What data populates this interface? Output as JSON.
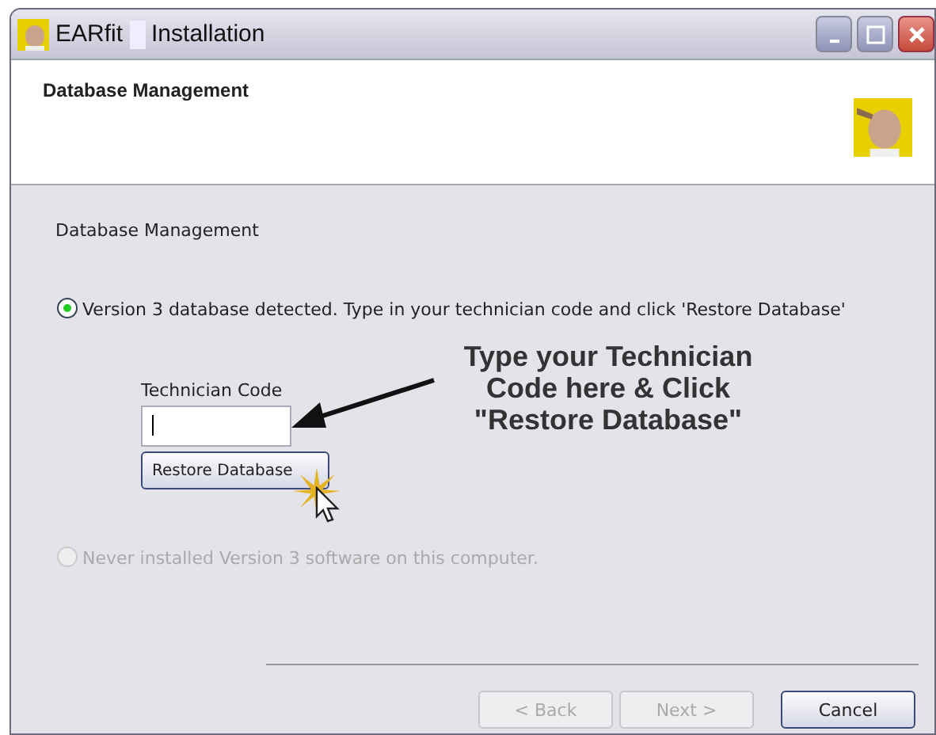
{
  "window": {
    "title_parts": [
      "EARfit",
      "Installation"
    ]
  },
  "header": {
    "title": "Database Management"
  },
  "group": {
    "label": "Database Management"
  },
  "options": [
    {
      "label": "Version 3 database detected. Type in your technician code and click 'Restore Database'",
      "selected": true,
      "disabled": false
    },
    {
      "label": "Never installed Version 3 software on this computer.",
      "selected": false,
      "disabled": true
    }
  ],
  "technician_code": {
    "label": "Technician Code",
    "focused": true
  },
  "restore_button": "Restore Database",
  "annotation": "Type your Technician\nCode here & Click\n\"Restore Database\"",
  "buttons": [
    {
      "label": "< Back",
      "disabled": true
    },
    {
      "label": "Next >",
      "disabled": true
    },
    {
      "label": "Cancel",
      "disabled": false
    }
  ]
}
